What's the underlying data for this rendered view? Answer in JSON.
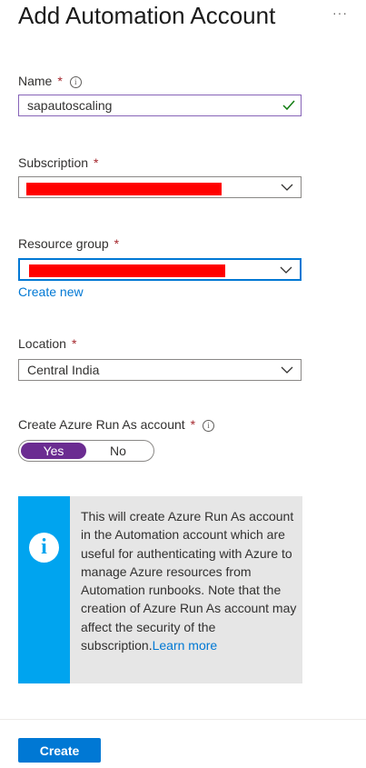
{
  "header": {
    "title": "Add Automation Account",
    "more": "···"
  },
  "fields": {
    "name": {
      "label": "Name",
      "required": "*",
      "value": "sapautoscaling"
    },
    "subscription": {
      "label": "Subscription",
      "required": "*"
    },
    "resource_group": {
      "label": "Resource group",
      "required": "*",
      "create_new": "Create new"
    },
    "location": {
      "label": "Location",
      "required": "*",
      "value": "Central India"
    },
    "run_as": {
      "label": "Create Azure Run As account",
      "required": "*",
      "yes": "Yes",
      "no": "No",
      "selected": "Yes"
    }
  },
  "info_box": {
    "icon": "info-icon",
    "text": "This will create Azure Run As account in the Automation account which are useful for authenticating with Azure to manage Azure resources from Automation runbooks. Note that the creation of Azure Run As account may affect the security of the subscription.",
    "link": "Learn more"
  },
  "footer": {
    "create_label": "Create"
  },
  "colors": {
    "accent": "#0078d4",
    "toggle": "#6b2c91",
    "info_stripe": "#00a4ef",
    "required": "#a4262c",
    "redaction": "#ff0000"
  }
}
